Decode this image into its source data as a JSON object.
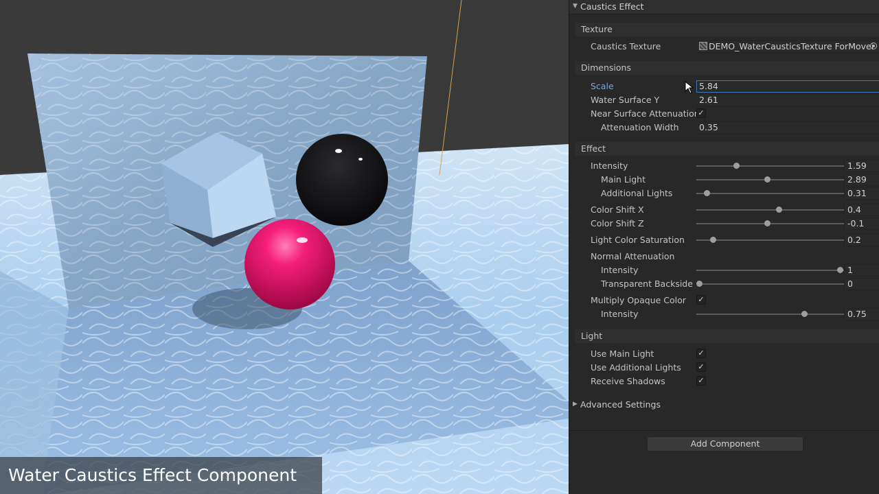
{
  "caption": "Water Caustics Effect Component",
  "inspector": {
    "component_title": "Caustics Effect",
    "texture_section": "Texture",
    "caustics_texture_label": "Caustics Texture",
    "caustics_texture_value": "DEMO_WaterCausticsTexture ForMovei",
    "dimensions_section": "Dimensions",
    "scale_label": "Scale",
    "scale_value": "5.84",
    "water_surface_y_label": "Water Surface Y",
    "water_surface_y_value": "2.61",
    "near_surface_attenuation_label": "Near Surface Attenuation",
    "near_surface_attenuation_checked": true,
    "attenuation_width_label": "Attenuation Width",
    "attenuation_width_value": "0.35",
    "effect_section": "Effect",
    "sliders": [
      {
        "label": "Intensity",
        "value": "1.59",
        "fraction": 0.27
      },
      {
        "label": "Main Light",
        "value": "2.89",
        "fraction": 0.48
      },
      {
        "label": "Additional Lights",
        "value": "0.31",
        "fraction": 0.07
      },
      {
        "label": "Color Shift X",
        "value": "0.4",
        "fraction": 0.56
      },
      {
        "label": "Color Shift Z",
        "value": "-0.1",
        "fraction": 0.48
      },
      {
        "label": "Light Color Saturation",
        "value": "0.2",
        "fraction": 0.11
      },
      {
        "label": "Intensity",
        "value": "1",
        "fraction": 0.97
      },
      {
        "label": "Transparent Backside",
        "value": "0",
        "fraction": 0.02
      },
      {
        "label": "Intensity",
        "value": "0.75",
        "fraction": 0.73
      }
    ],
    "normal_attenuation_label": "Normal Attenuation",
    "multiply_opaque_color_label": "Multiply Opaque Color",
    "multiply_opaque_color_checked": true,
    "light_section": "Light",
    "use_main_light_label": "Use Main Light",
    "use_additional_lights_label": "Use Additional Lights",
    "receive_shadows_label": "Receive Shadows",
    "advanced_settings_label": "Advanced Settings",
    "add_component_label": "Add Component",
    "checkmark": "✓"
  }
}
